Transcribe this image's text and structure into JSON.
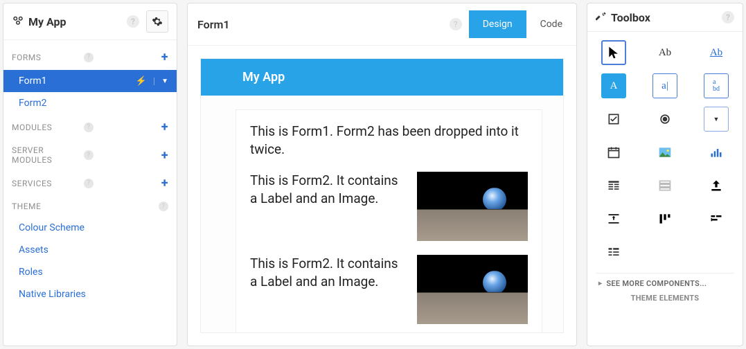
{
  "sidebar": {
    "title": "My App",
    "sections": {
      "forms": {
        "label": "FORMS"
      },
      "modules": {
        "label": "MODULES"
      },
      "server_modules": {
        "label": "SERVER MODULES"
      },
      "services": {
        "label": "SERVICES"
      },
      "theme": {
        "label": "THEME"
      }
    },
    "forms": [
      {
        "label": "Form1"
      },
      {
        "label": "Form2"
      }
    ],
    "theme_items": [
      {
        "label": "Colour Scheme"
      },
      {
        "label": "Assets"
      },
      {
        "label": "Roles"
      },
      {
        "label": "Native Libraries"
      }
    ]
  },
  "center": {
    "title": "Form1",
    "tabs": {
      "design": "Design",
      "code": "Code"
    },
    "app_title": "My App",
    "intro": "This is Form1. Form2 has been dropped into it twice.",
    "form2_text": "This is Form2. It contains a Label and an Image."
  },
  "toolbox": {
    "title": "Toolbox",
    "see_more": "SEE MORE COMPONENTS...",
    "theme_elements": "THEME ELEMENTS"
  }
}
